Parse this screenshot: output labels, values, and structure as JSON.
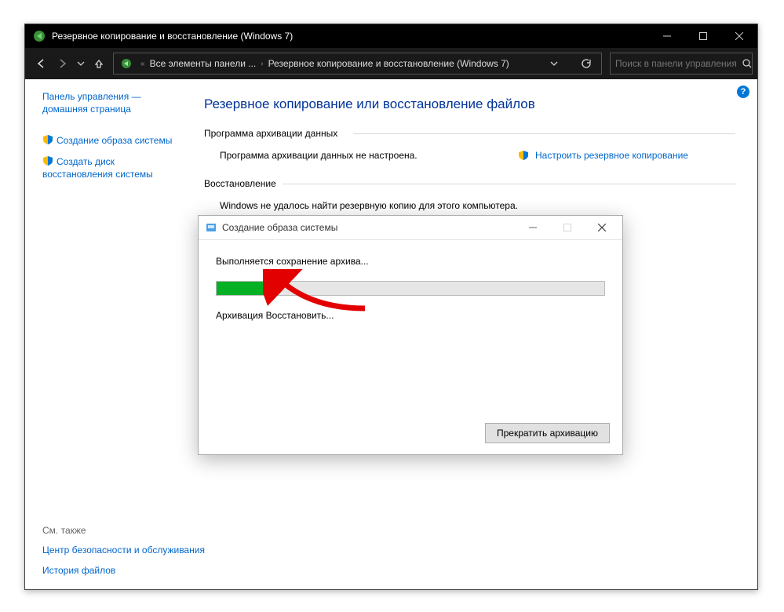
{
  "window": {
    "title": "Резервное копирование и восстановление (Windows 7)"
  },
  "nav": {
    "crumb1": "Все элементы панели ...",
    "crumb2": "Резервное копирование и восстановление (Windows 7)",
    "search_placeholder": "Поиск в панели управления"
  },
  "sidebar": {
    "home": "Панель управления — домашняя страница",
    "create_image": "Создание образа системы",
    "create_disk": "Создать диск восстановления системы",
    "see_also_h": "См. также",
    "security": "Центр безопасности и обслуживания",
    "history": "История файлов"
  },
  "content": {
    "title": "Резервное копирование или восстановление файлов",
    "group_archive": "Программа архивации данных",
    "archive_msg": "Программа архивации данных не настроена.",
    "configure_backup": "Настроить резервное копирование",
    "group_restore": "Восстановление",
    "restore_msg": "Windows не удалось найти резервную копию для этого компьютера."
  },
  "modal": {
    "title": "Создание образа системы",
    "status": "Выполняется сохранение архива...",
    "subtext": "Архивация Восстановить...",
    "stop_btn": "Прекратить архивацию",
    "progress_pct": 16
  }
}
